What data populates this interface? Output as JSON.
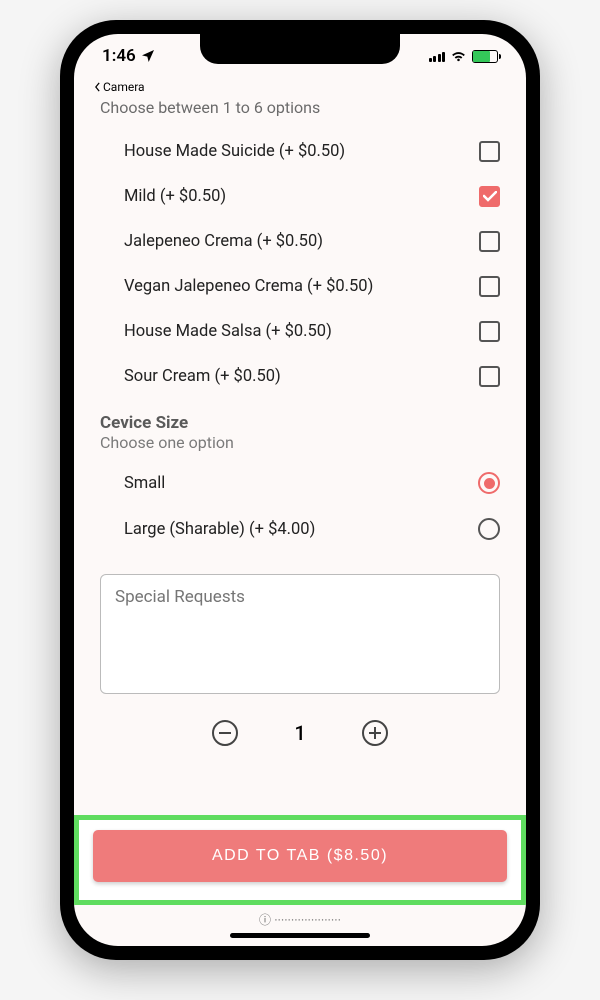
{
  "status": {
    "time": "1:46",
    "back_app": "Camera"
  },
  "addons": {
    "hint": "Choose between 1 to 6 options",
    "items": [
      {
        "label": "House Made Suicide (+ $0.50)",
        "checked": false
      },
      {
        "label": "Mild (+ $0.50)",
        "checked": true
      },
      {
        "label": "Jalepeneo Crema (+ $0.50)",
        "checked": false
      },
      {
        "label": "Vegan Jalepeneo Crema (+ $0.50)",
        "checked": false
      },
      {
        "label": "House Made Salsa (+ $0.50)",
        "checked": false
      },
      {
        "label": "Sour Cream (+ $0.50)",
        "checked": false
      }
    ]
  },
  "size": {
    "title": "Cevice Size",
    "hint": "Choose one option",
    "options": [
      {
        "label": "Small",
        "selected": true
      },
      {
        "label": "Large (Sharable) (+ $4.00)",
        "selected": false
      }
    ]
  },
  "special_requests": {
    "placeholder": "Special Requests"
  },
  "quantity": 1,
  "cta_label": "ADD TO TAB ($8.50)"
}
